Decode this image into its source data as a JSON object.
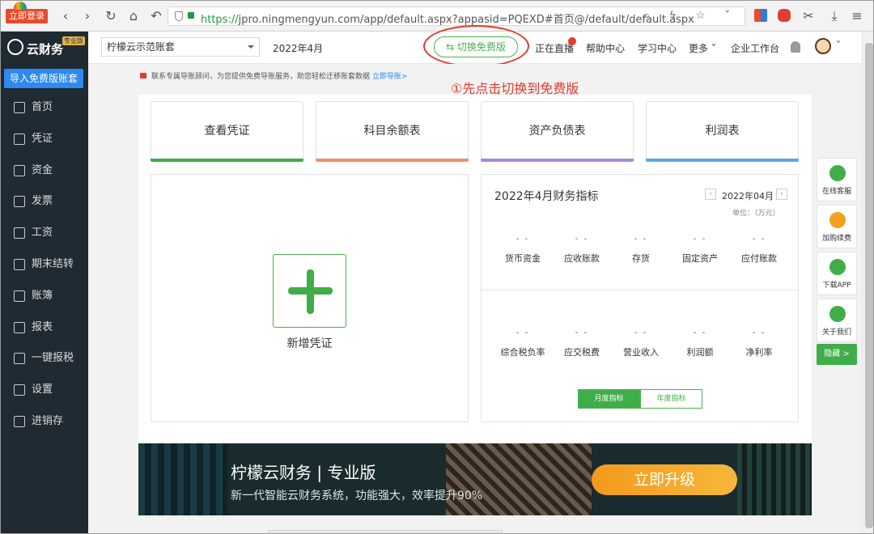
{
  "browser": {
    "login_badge": "立即登录",
    "url_scheme": "https://",
    "url_rest": "jpro.ningmengyun.com/app/default.aspx?appasid=PQEXD#首页@/default/default.aspx",
    "nav_icons": [
      "back-icon",
      "forward-icon",
      "reload-icon",
      "home-icon",
      "undo-icon"
    ]
  },
  "header": {
    "logo": "云财务",
    "logo_tag": "专业版",
    "account_select": "柠檬云示范账套",
    "period": "2022年4月",
    "switch_free": "⇆  切换免费版",
    "live": "正在直播",
    "help": "帮助中心",
    "learn": "学习中心",
    "more": "更多 ˅",
    "enterprise": "企业工作台"
  },
  "sidebar": {
    "import": "导入免费版账套",
    "items": [
      {
        "label": "首页",
        "icon": "home-icon"
      },
      {
        "label": "凭证",
        "icon": "voucher-icon"
      },
      {
        "label": "资金",
        "icon": "fund-icon"
      },
      {
        "label": "发票",
        "icon": "invoice-icon"
      },
      {
        "label": "工资",
        "icon": "salary-icon"
      },
      {
        "label": "期末结转",
        "icon": "period-close-icon"
      },
      {
        "label": "账簿",
        "icon": "ledger-icon"
      },
      {
        "label": "报表",
        "icon": "report-icon"
      },
      {
        "label": "一键报税",
        "icon": "tax-icon"
      },
      {
        "label": "设置",
        "icon": "gear-icon"
      },
      {
        "label": "进销存",
        "icon": "inventory-icon"
      }
    ]
  },
  "notice": {
    "text": "联系专属导账顾问，为您提供免费导账服务，助您轻松迁移账套数据",
    "link": "立即导账>"
  },
  "annotation": "①先点击切换到免费版",
  "cards": [
    {
      "label": "查看凭证",
      "color": "#3fae49"
    },
    {
      "label": "科目余额表",
      "color": "#f08f6f"
    },
    {
      "label": "资产负债表",
      "color": "#a98ad8"
    },
    {
      "label": "利润表",
      "color": "#5aa9e6"
    }
  ],
  "add_voucher": "新增凭证",
  "finance": {
    "title": "2022年4月财务指标",
    "period": "2022年04月",
    "unit": "单位：（万元）",
    "row1": [
      {
        "value": "- -",
        "label": "货币资金"
      },
      {
        "value": "- -",
        "label": "应收账款"
      },
      {
        "value": "- -",
        "label": "存货"
      },
      {
        "value": "- -",
        "label": "固定资产"
      },
      {
        "value": "- -",
        "label": "应付账款"
      }
    ],
    "row2": [
      {
        "value": "- -",
        "label": "综合税负率"
      },
      {
        "value": "- -",
        "label": "应交税费"
      },
      {
        "value": "- -",
        "label": "营业收入"
      },
      {
        "value": "- -",
        "label": "利润额"
      },
      {
        "value": "- -",
        "label": "净利率"
      }
    ],
    "tab_month": "月度指标",
    "tab_year": "年度指标"
  },
  "float_panel": [
    {
      "label": "在线客服",
      "icon": "headset-icon",
      "color": "#3fae49"
    },
    {
      "label": "加购续费",
      "icon": "crown-icon",
      "color": "#f3a21e"
    },
    {
      "label": "下载APP",
      "icon": "phone-icon",
      "color": "#3fae49"
    },
    {
      "label": "关于我们",
      "icon": "wechat-icon",
      "color": "#3fae49"
    }
  ],
  "hide": "隐藏 >",
  "banner": {
    "title": "柠檬云财务 | 专业版",
    "subtitle": "新一代智能云财务系统，功能强大，效率提升90%",
    "button": "立即升级"
  }
}
